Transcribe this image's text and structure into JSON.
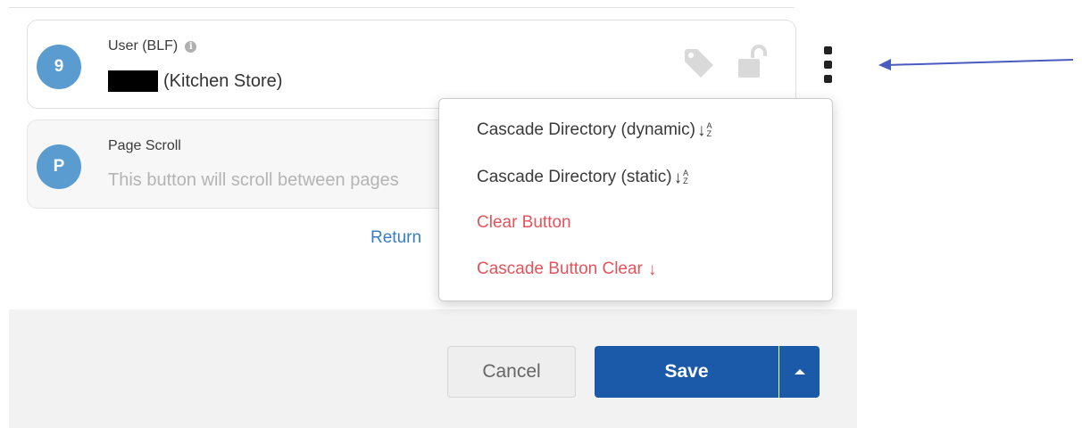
{
  "cards": [
    {
      "avatar": "9",
      "title": "User (BLF)",
      "subtitle": "(Kitchen Store)"
    },
    {
      "avatar": "P",
      "title": "Page Scroll",
      "subtitle": "This button will scroll between pages"
    }
  ],
  "return_link": "Return",
  "menu": {
    "items": [
      {
        "label": "Cascade Directory (dynamic)",
        "icon": "sort-down-az-icon",
        "danger": false
      },
      {
        "label": "Cascade Directory (static)",
        "icon": "sort-down-az-icon",
        "danger": false
      },
      {
        "label": "Clear Button",
        "danger": true
      },
      {
        "label": "Cascade Button Clear",
        "icon": "arrow-down-icon",
        "danger": true
      }
    ]
  },
  "footer": {
    "cancel_label": "Cancel",
    "save_label": "Save"
  },
  "colors": {
    "accent": "#1b5aa8",
    "avatar": "#5a9bd0",
    "danger": "#e2545b",
    "link": "#3a7dc0",
    "annotation_arrow": "#4a5bbf"
  }
}
